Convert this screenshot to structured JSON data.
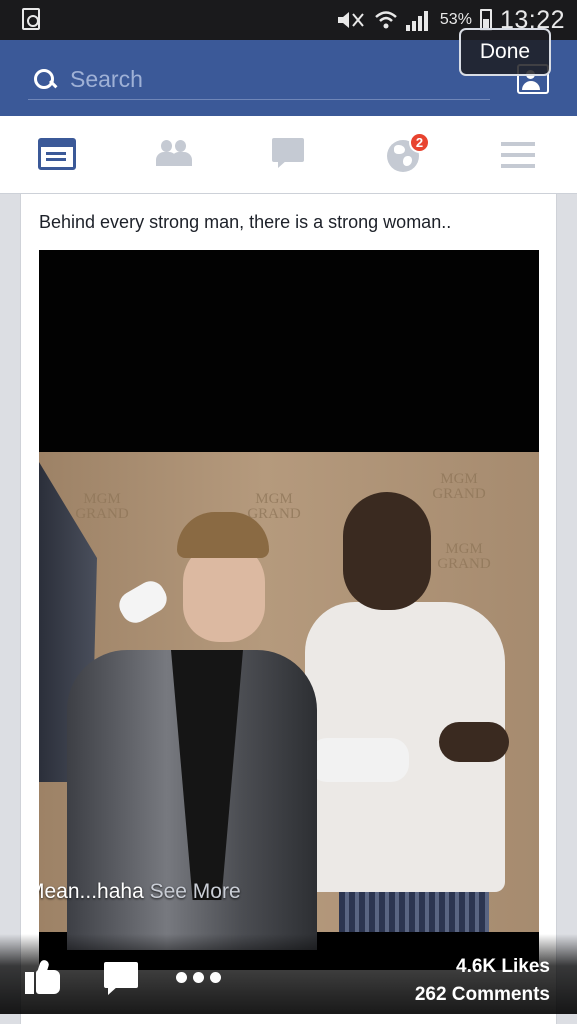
{
  "status_bar": {
    "battery_percent": "53%",
    "time": "13:22"
  },
  "header": {
    "search_placeholder": "Search",
    "done_label": "Done"
  },
  "nav": {
    "notifications_badge": "2"
  },
  "post": {
    "text": "Behind every strong man, there is a strong woman..",
    "caption": "Mean...haha",
    "see_more": "See More",
    "wall_logo": "MGM GRAND",
    "likes": "4.6K Likes",
    "comments": "262 Comments"
  },
  "colors": {
    "facebook_blue": "#3b5998",
    "badge_red": "#e8432f",
    "inactive_icon": "#c5cad3"
  },
  "icons": [
    "search-icon",
    "friend-requests-icon",
    "news-feed-icon",
    "friends-icon",
    "messages-icon",
    "notifications-globe-icon",
    "menu-icon",
    "like-icon",
    "comment-icon",
    "more-options-icon"
  ]
}
